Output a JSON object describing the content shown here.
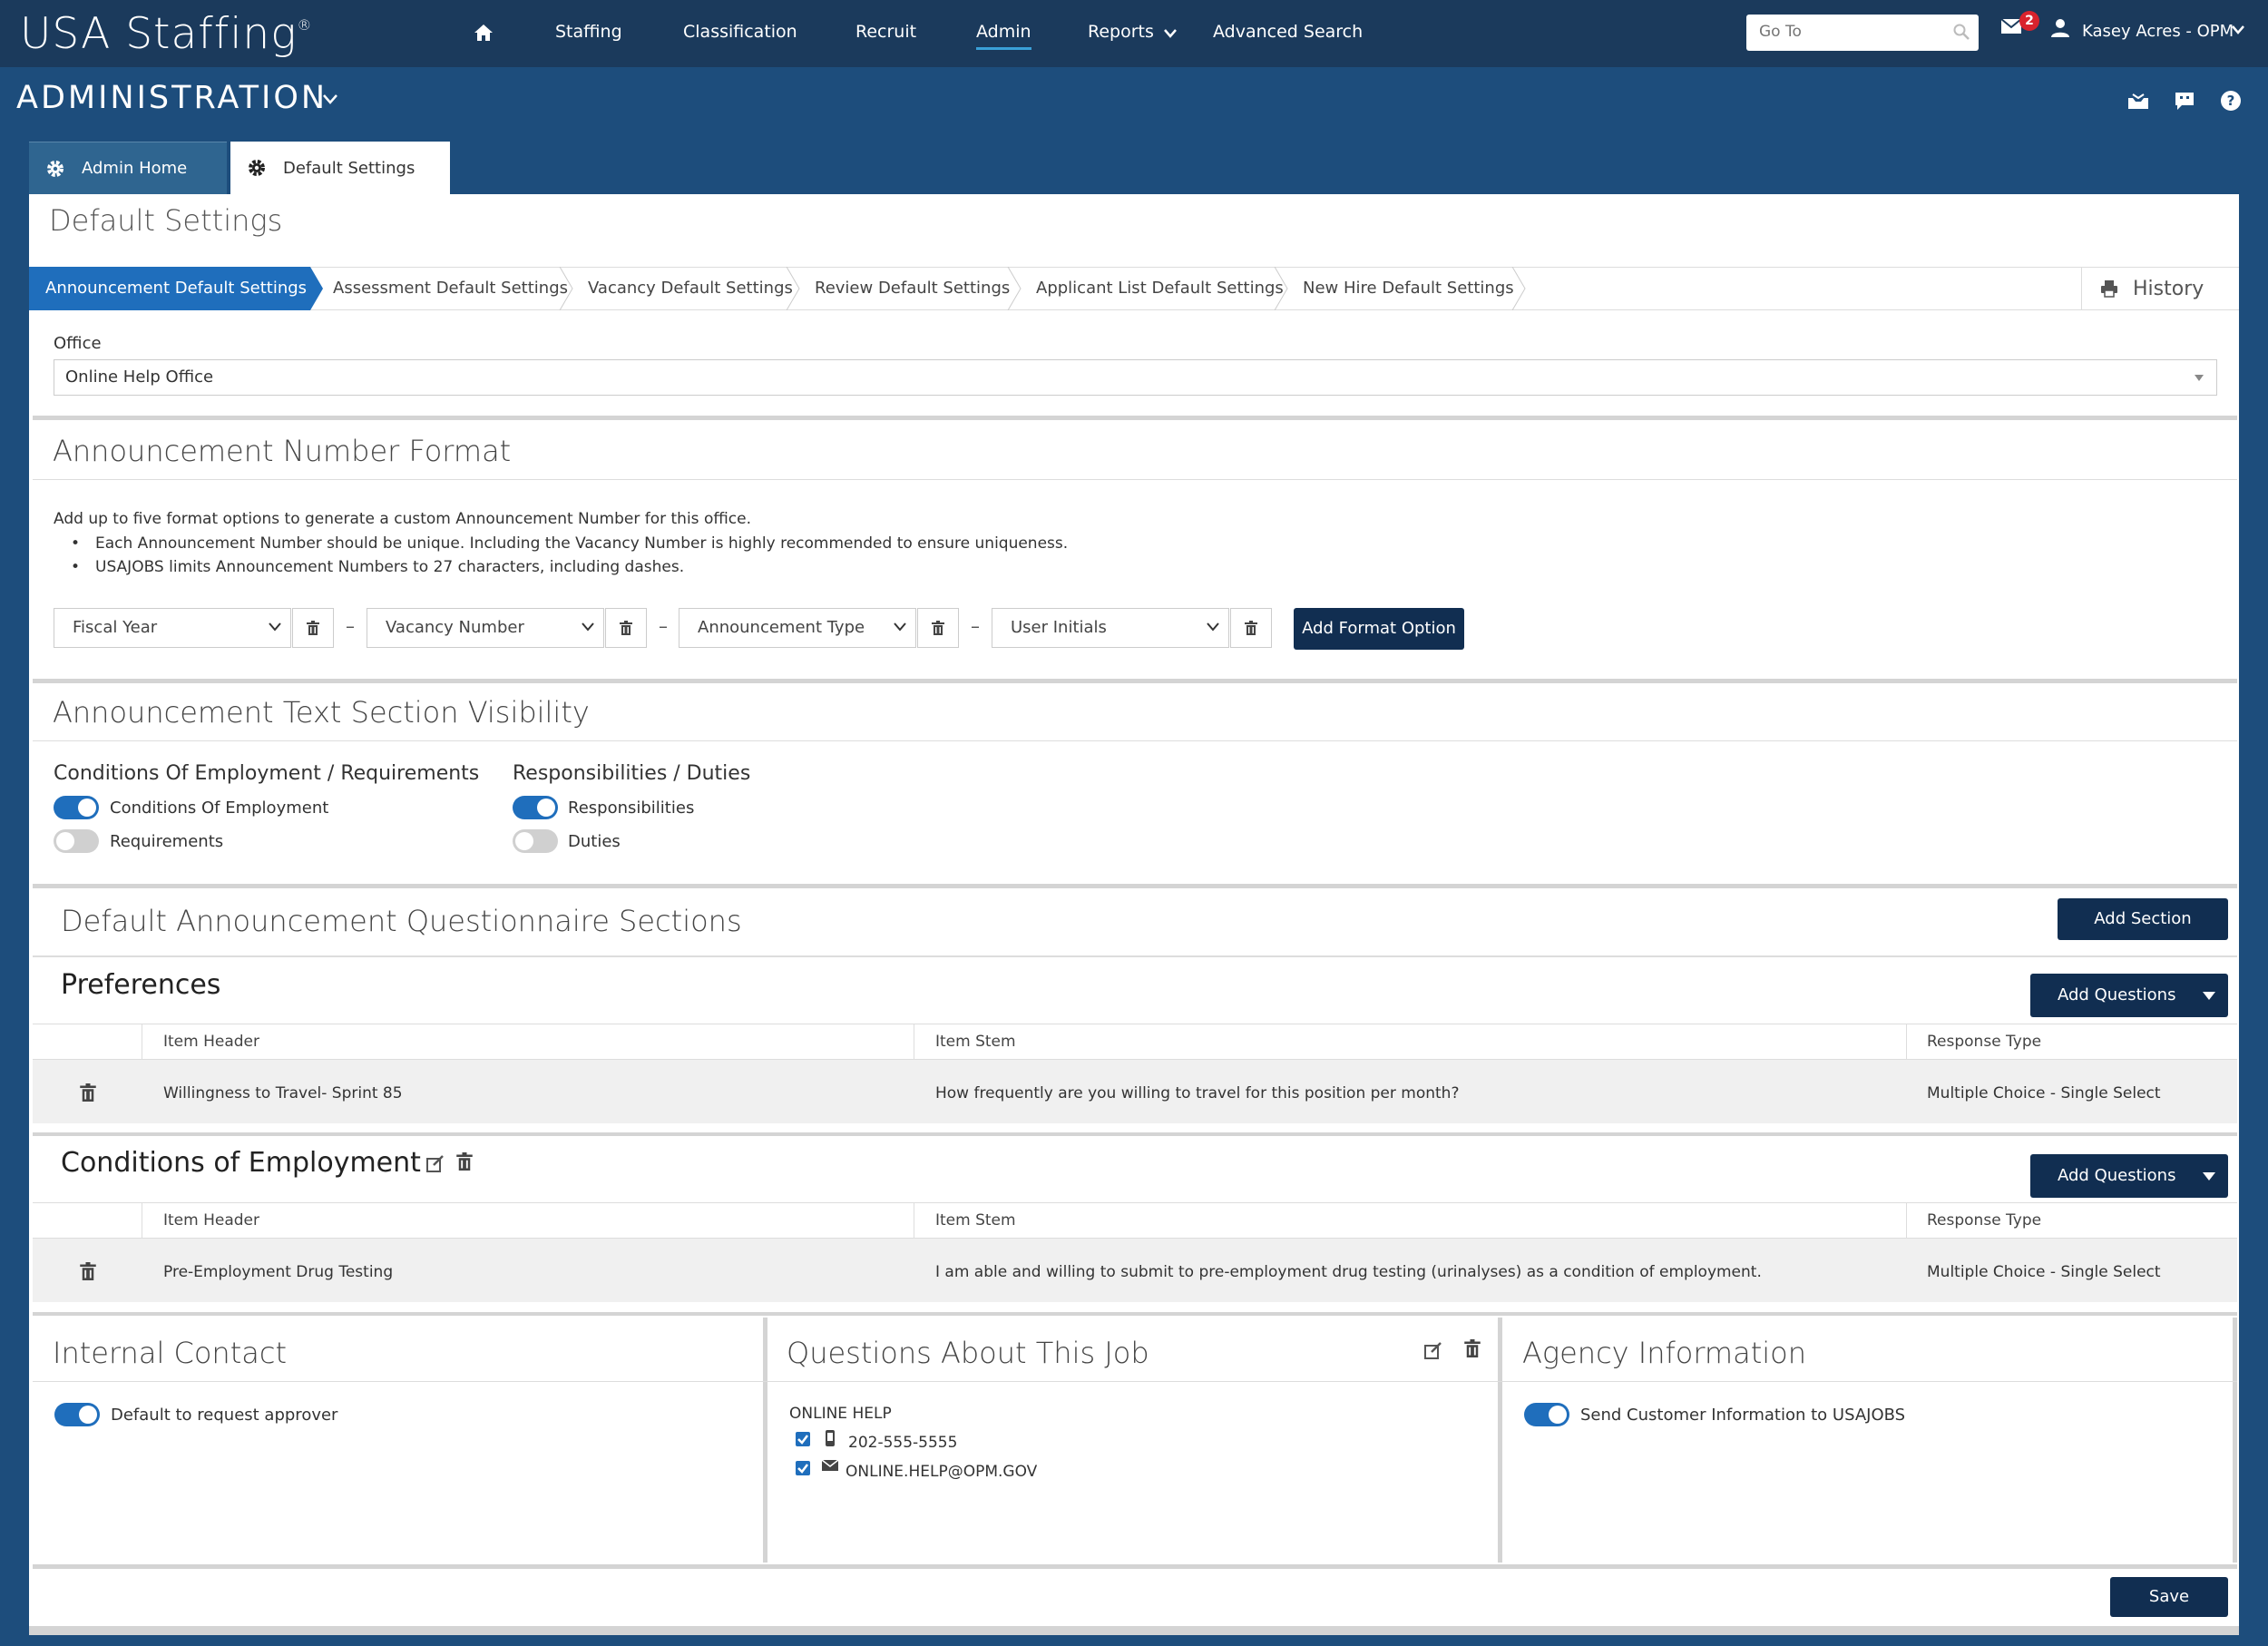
{
  "app": {
    "logo": "USA Staffing",
    "logo_mark": "®"
  },
  "nav": {
    "items": [
      {
        "label": "Staffing"
      },
      {
        "label": "Classification"
      },
      {
        "label": "Recruit"
      },
      {
        "label": "Admin",
        "active": true
      },
      {
        "label": "Reports"
      },
      {
        "label": "Advanced Search"
      }
    ],
    "goto_placeholder": "Go To",
    "mail_badge": "2",
    "user_name": "Kasey Acres - OPM"
  },
  "header": {
    "section": "ADMINISTRATION"
  },
  "page_tabs": [
    {
      "label": "Admin Home"
    },
    {
      "label": "Default Settings",
      "active": true
    }
  ],
  "page_title": "Default Settings",
  "sub_tabs": [
    {
      "label": "Announcement Default Settings",
      "active": true
    },
    {
      "label": "Assessment Default Settings"
    },
    {
      "label": "Vacancy Default Settings"
    },
    {
      "label": "Review Default Settings"
    },
    {
      "label": "Applicant List Default Settings"
    },
    {
      "label": "New Hire Default Settings"
    }
  ],
  "history_label": "History",
  "office": {
    "label": "Office",
    "value": "Online Help Office"
  },
  "number_format": {
    "title": "Announcement Number Format",
    "intro": "Add up to five format options to generate a custom Announcement Number for this office.",
    "bullets": [
      "Each Announcement Number should be unique. Including the Vacancy Number is highly recommended to ensure uniqueness.",
      "USAJOBS limits Announcement Numbers to 27 characters, including dashes."
    ],
    "options": [
      "Fiscal Year",
      "Vacancy Number",
      "Announcement Type",
      "User Initials"
    ],
    "separator": "–",
    "add_button": "Add Format Option"
  },
  "text_visibility": {
    "title": "Announcement Text Section Visibility",
    "groups": [
      {
        "title": "Conditions Of Employment / Requirements",
        "toggles": [
          {
            "label": "Conditions Of Employment",
            "on": true
          },
          {
            "label": "Requirements",
            "on": false
          }
        ]
      },
      {
        "title": "Responsibilities / Duties",
        "toggles": [
          {
            "label": "Responsibilities",
            "on": true
          },
          {
            "label": "Duties",
            "on": false
          }
        ]
      }
    ]
  },
  "questionnaire": {
    "title": "Default Announcement Questionnaire Sections",
    "add_section": "Add Section",
    "add_questions": "Add Questions",
    "columns": [
      "Item Header",
      "Item Stem",
      "Response Type"
    ],
    "sections": [
      {
        "title": "Preferences",
        "rows": [
          {
            "header": "Willingness to Travel- Sprint 85",
            "stem": "How frequently are you willing to travel for this position per month?",
            "type": "Multiple Choice - Single Select"
          }
        ]
      },
      {
        "title": "Conditions of Employment",
        "rows": [
          {
            "header": "Pre-Employment Drug Testing",
            "stem": "I am able and willing to submit to pre-employment drug testing (urinalyses) as a condition of employment.",
            "type": "Multiple Choice - Single Select"
          }
        ]
      }
    ]
  },
  "internal_contact": {
    "title": "Internal Contact",
    "toggle_label": "Default to request approver",
    "toggle_on": true
  },
  "questions_job": {
    "title": "Questions About This Job",
    "org": "ONLINE HELP",
    "phone": "202-555-5555",
    "email": "ONLINE.HELP@OPM.GOV"
  },
  "agency_info": {
    "title": "Agency Information",
    "toggle_label": "Send Customer Information to USAJOBS",
    "toggle_on": true
  },
  "save_label": "Save",
  "colors": {
    "nav_bg": "#1b3a5c",
    "page_bg": "#1d4d7c",
    "accent": "#1f6ebc",
    "button_dark": "#112e51",
    "badge": "#d9232d"
  }
}
